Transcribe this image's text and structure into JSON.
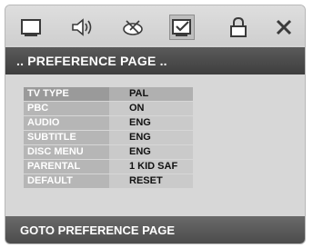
{
  "header": {
    "icons": [
      {
        "name": "tv-screen-icon"
      },
      {
        "name": "speaker-audio-icon"
      },
      {
        "name": "dolby-decoder-icon"
      },
      {
        "name": "preference-check-icon"
      },
      {
        "name": "padlock-icon"
      },
      {
        "name": "close-icon"
      }
    ],
    "active_icon": "preference-check-icon"
  },
  "title": ".. PREFERENCE PAGE ..",
  "settings": [
    {
      "label": "TV TYPE",
      "value": "PAL"
    },
    {
      "label": "PBC",
      "value": "ON"
    },
    {
      "label": "AUDIO",
      "value": "ENG"
    },
    {
      "label": "SUBTITLE",
      "value": "ENG"
    },
    {
      "label": "DISC MENU",
      "value": "ENG"
    },
    {
      "label": "PARENTAL",
      "value": "1 KID SAF"
    },
    {
      "label": "DEFAULT",
      "value": "RESET"
    }
  ],
  "status": "GOTO PREFERENCE PAGE",
  "colors": {
    "frame": "#d3d3d3",
    "title_bar": "#4a4a4a",
    "label_cell": "#b6b6b6",
    "value_cell": "#cacaca",
    "highlight": "#9a9a9a"
  }
}
